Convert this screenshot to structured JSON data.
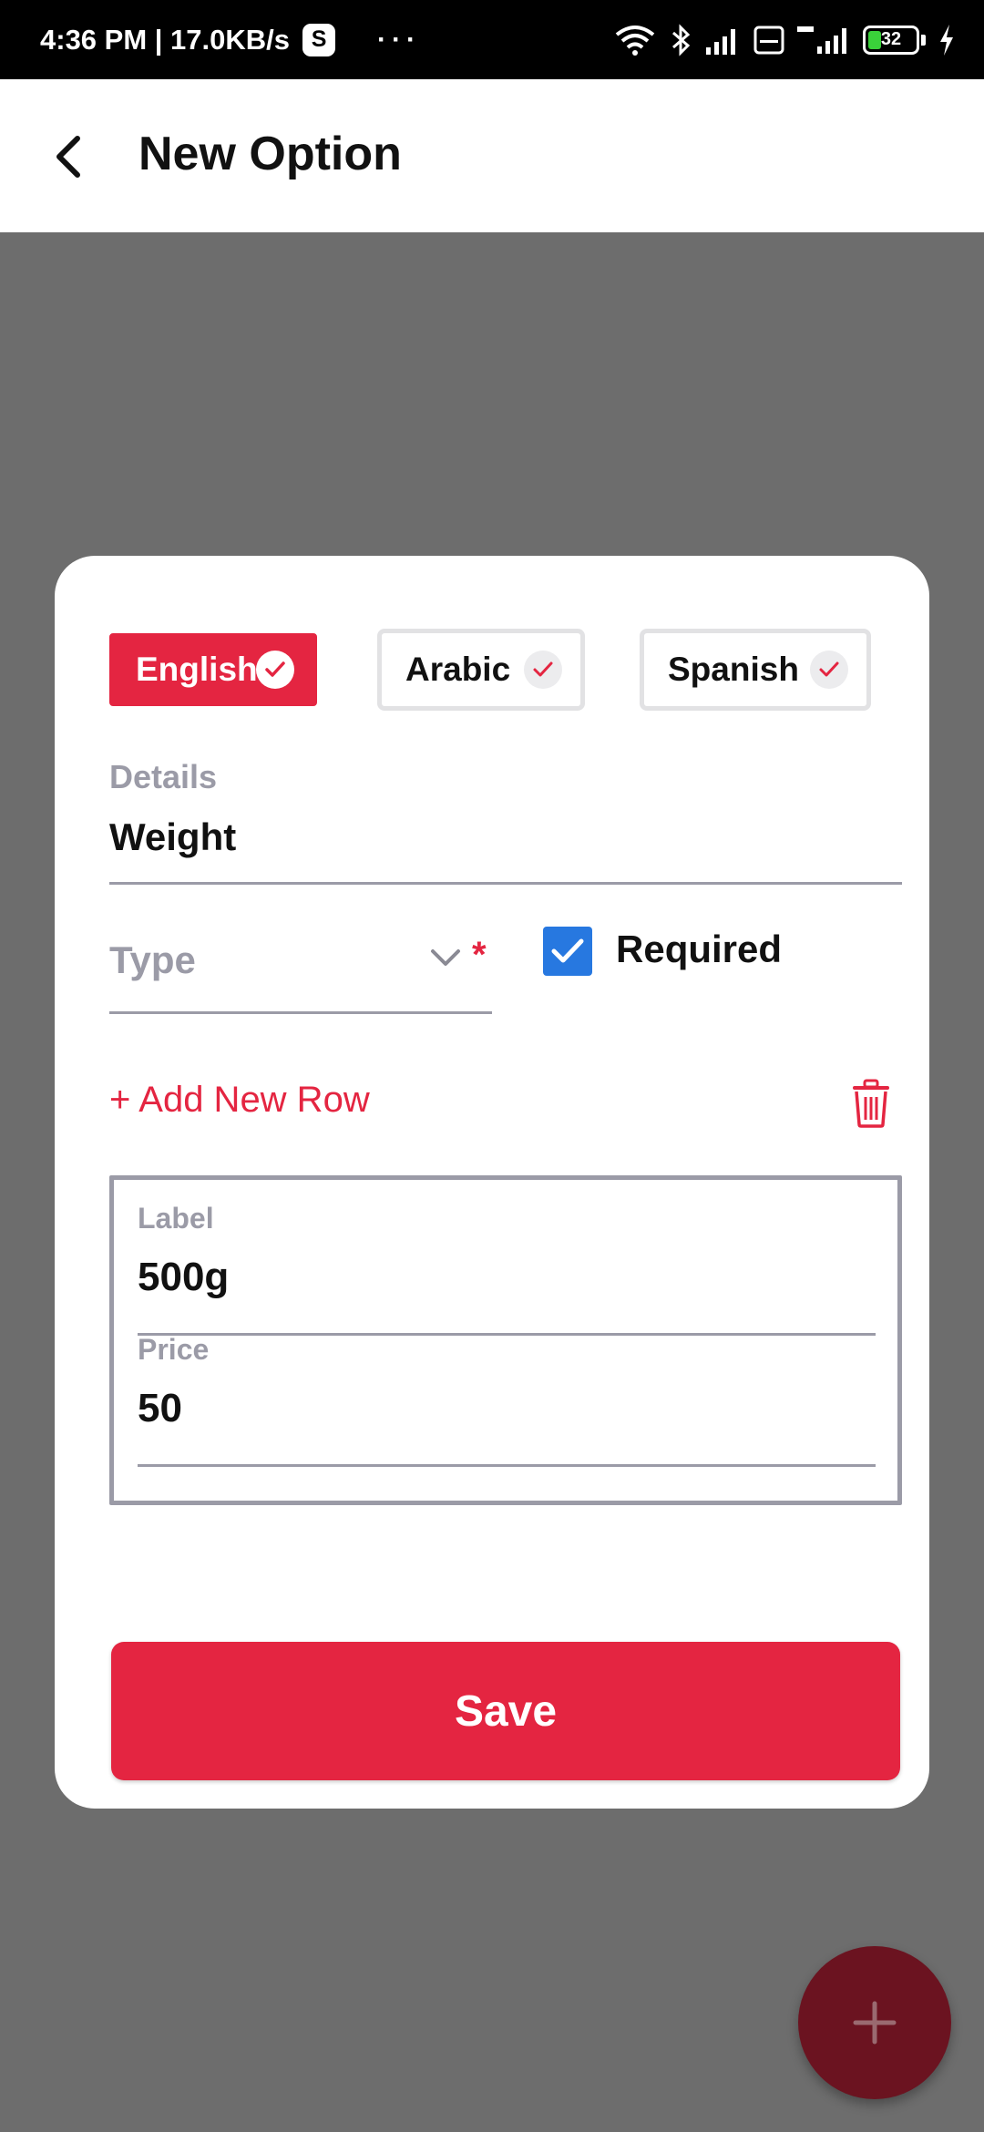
{
  "status_bar": {
    "time_speed": "4:36 PM | 17.0KB/s",
    "app_badge": "S",
    "more": "···",
    "battery": "32"
  },
  "app_bar": {
    "title": "New Option",
    "back_icon": "chevron-left-icon"
  },
  "languages": [
    {
      "label": "English",
      "active": true
    },
    {
      "label": "Arabic",
      "active": false
    },
    {
      "label": "Spanish",
      "active": false
    }
  ],
  "details": {
    "label": "Details",
    "value": "Weight"
  },
  "type_field": {
    "placeholder": "Type",
    "required_marker": "*"
  },
  "required": {
    "label": "Required",
    "checked": true
  },
  "add_row": {
    "label": "+ Add New Row"
  },
  "row": {
    "label_title": "Label",
    "label_value": "500g",
    "price_title": "Price",
    "price_value": "50"
  },
  "save": {
    "label": "Save"
  },
  "colors": {
    "accent": "#e42541",
    "checkbox": "#2778e0",
    "muted": "#9b9ba7",
    "overlay": "#6d6d6d",
    "fab": "#6b1320"
  }
}
